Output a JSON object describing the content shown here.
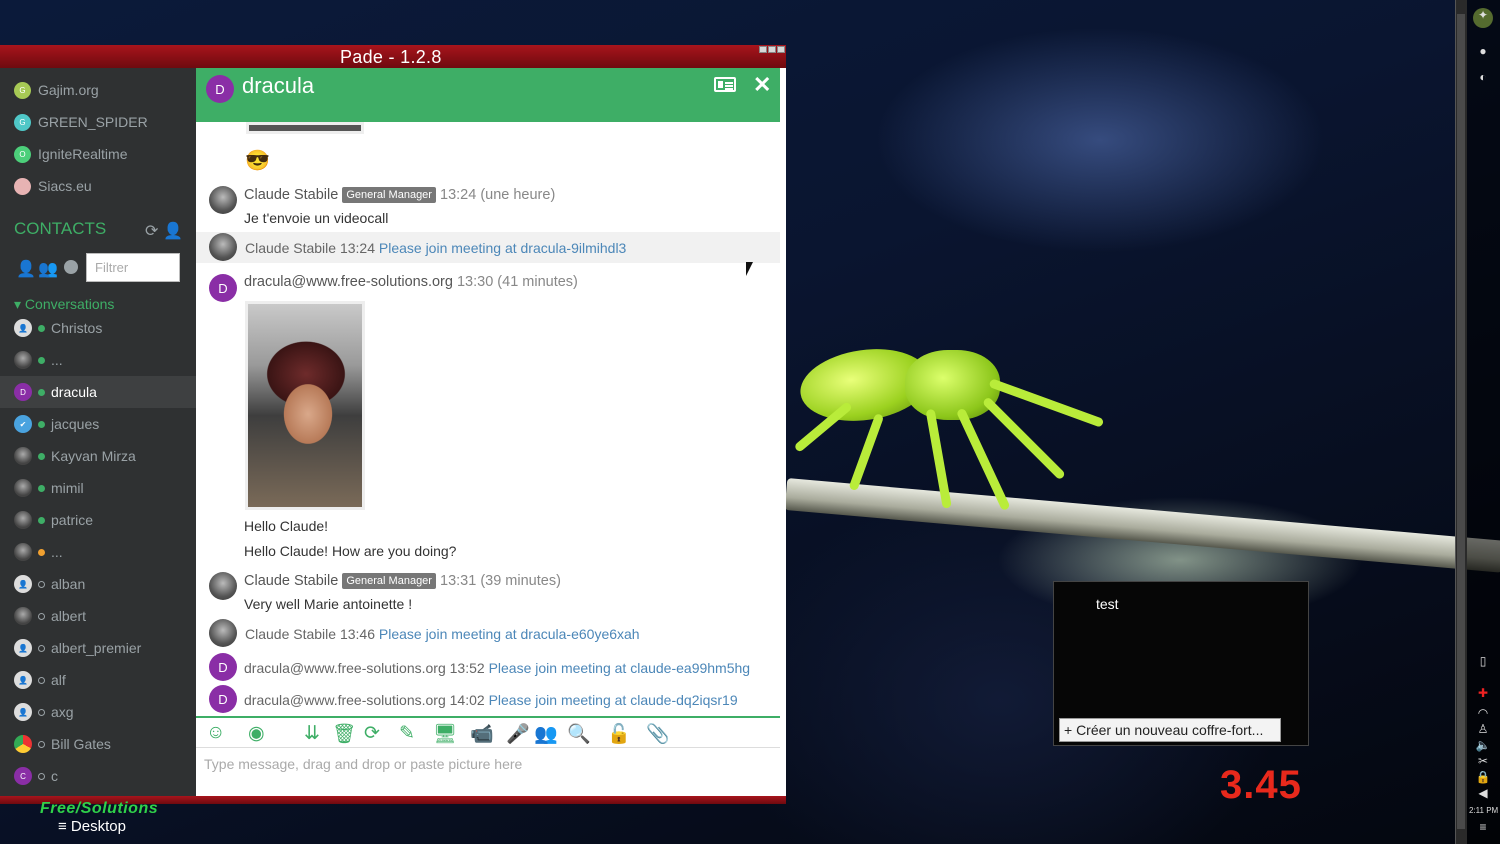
{
  "app": {
    "title": "Pade - 1.2.8"
  },
  "sidebar": {
    "groupchats": [
      {
        "label": "Gajim.org",
        "initial": "G",
        "color": "#a7c955"
      },
      {
        "label": "GREEN_SPIDER",
        "initial": "G",
        "color": "#4fc7c7"
      },
      {
        "label": "IgniteRealtime",
        "initial": "O",
        "color": "#4ccf7a"
      },
      {
        "label": "Siacs.eu",
        "initial": "",
        "color": "#e7b3b3"
      }
    ],
    "contacts_heading": "CONTACTS",
    "filter_placeholder": "Filtrer",
    "conversations_heading": "Conversations",
    "contacts": [
      {
        "name": "Christos",
        "status": "online",
        "avatar": "person-icon"
      },
      {
        "name": "...",
        "status": "online",
        "avatar": "photo"
      },
      {
        "name": "dracula",
        "status": "online",
        "avatar": "D",
        "active": true
      },
      {
        "name": "jacques",
        "status": "online",
        "avatar": "check-icon"
      },
      {
        "name": "Kayvan Mirza",
        "status": "online",
        "avatar": "photo"
      },
      {
        "name": "mimil",
        "status": "online",
        "avatar": "photo"
      },
      {
        "name": "patrice",
        "status": "online",
        "avatar": "photo"
      },
      {
        "name": "...",
        "status": "away",
        "avatar": "photo"
      },
      {
        "name": "alban",
        "status": "offline",
        "avatar": "person-icon"
      },
      {
        "name": "albert",
        "status": "offline",
        "avatar": "photo"
      },
      {
        "name": "albert_premier",
        "status": "offline",
        "avatar": "person-icon"
      },
      {
        "name": "alf",
        "status": "offline",
        "avatar": "person-icon"
      },
      {
        "name": "axg",
        "status": "offline",
        "avatar": "person-icon"
      },
      {
        "name": "Bill Gates",
        "status": "offline",
        "avatar": "chrome-icon"
      },
      {
        "name": "c",
        "status": "offline",
        "avatar": "C"
      }
    ],
    "status_colors": {
      "online": "#3eae66",
      "away": "#f0a030",
      "offline": "#9aa2a6"
    }
  },
  "chat": {
    "contact_name": "dracula",
    "avatar_initial": "D",
    "messages": {
      "emoji": "😎",
      "m1": {
        "sender": "Claude Stabile",
        "badge": "General Manager",
        "time": "13:24 (une heure)",
        "text": "Je t'envoie un videocall"
      },
      "m2": {
        "meta": "Claude Stabile 13:24 ",
        "link": "Please join meeting at dracula-9ilmihdl3"
      },
      "m3": {
        "sender": "dracula@www.free-solutions.org",
        "time": "13:30 (41 minutes)",
        "text1": "Hello Claude!",
        "text2": "Hello Claude! How are you doing?"
      },
      "m4": {
        "sender": "Claude Stabile",
        "badge": "General Manager",
        "time": "13:31 (39 minutes)",
        "text": "Very well Marie antoinette !"
      },
      "m5": {
        "meta": "Claude Stabile 13:46 ",
        "link": "Please join meeting at dracula-e60ye6xah"
      },
      "m6": {
        "meta": "dracula@www.free-solutions.org 13:52 ",
        "link": "Please join meeting at claude-ea99hm5hg"
      },
      "m7": {
        "meta": "dracula@www.free-solutions.org 14:02 ",
        "link": "Please join meeting at claude-dq2iqsr19"
      }
    },
    "input_placeholder": "Type message, drag and drop or paste picture here"
  },
  "taskbar": {
    "brand": "Free/Solutions",
    "desktop_label": "Desktop"
  },
  "vault": {
    "title": "test",
    "create_button": "+ Créer un nouveau coffre-fort..."
  },
  "overlay": {
    "big_number": "3.45",
    "tray_time": "2:11 PM"
  }
}
